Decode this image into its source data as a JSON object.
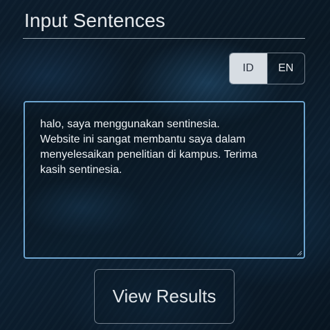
{
  "header": {
    "title": "Input Sentences"
  },
  "language_toggle": {
    "options": [
      {
        "label": "ID",
        "active": true
      },
      {
        "label": "EN",
        "active": false
      }
    ]
  },
  "input": {
    "value": "halo, saya menggunakan sentinesia.\nWebsite ini sangat membantu saya dalam\nmenyelesaikan penelitian di kampus. Terima\nkasih sentinesia."
  },
  "actions": {
    "view_results_label": "View Results"
  }
}
